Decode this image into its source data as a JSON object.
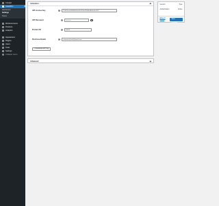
{
  "sidebar": {
    "items_top": [
      {
        "label": "Contact",
        "icon": "mail-icon"
      }
    ],
    "active": {
      "label": "CeteMCU",
      "icon": "plugin-icon"
    },
    "submenu": [
      "Dashboard",
      "Settings",
      "Status"
    ],
    "submenu_current": "Settings",
    "items_bottom": [
      {
        "label": "WooCommerce",
        "icon": "woocommerce-icon"
      },
      {
        "label": "Products",
        "icon": "products-icon"
      },
      {
        "label": "Analytics",
        "icon": "analytics-icon"
      },
      {
        "label": "Appearance",
        "icon": "appearance-icon"
      },
      {
        "label": "Plugins",
        "icon": "plugins-icon"
      },
      {
        "label": "Users",
        "icon": "users-icon"
      },
      {
        "label": "Tools",
        "icon": "tools-icon"
      },
      {
        "label": "Settings",
        "icon": "settings-icon"
      },
      {
        "label": "Collapse menu",
        "icon": "collapse-icon"
      }
    ]
  },
  "activation": {
    "title": "Activation",
    "api_license_key": {
      "label": "API License Key",
      "value": "C5b04aaeab8d4bfd4ae6e2fe5ba09d9dd4bbfaa6c4f07"
    },
    "api_password": {
      "label": "API Password",
      "value": "••••••••••"
    },
    "product_id": {
      "label": "Product ID",
      "value": "00025"
    },
    "purchase_email": {
      "label": "Purchase Emails",
      "value": "customer@mail@gmail.com"
    },
    "deactivate_label": "Deactivate API Key"
  },
  "advanced": {
    "title": "Advanced"
  },
  "side": {
    "rows": [
      {
        "left": "Version",
        "right": "Type"
      },
      {
        "left": "Authorization",
        "right": "Active"
      }
    ],
    "link": "Move to Basics",
    "save_label": "Save changes"
  },
  "colors": {
    "accent": "#2271b1",
    "sidebar": "#1d2327"
  }
}
